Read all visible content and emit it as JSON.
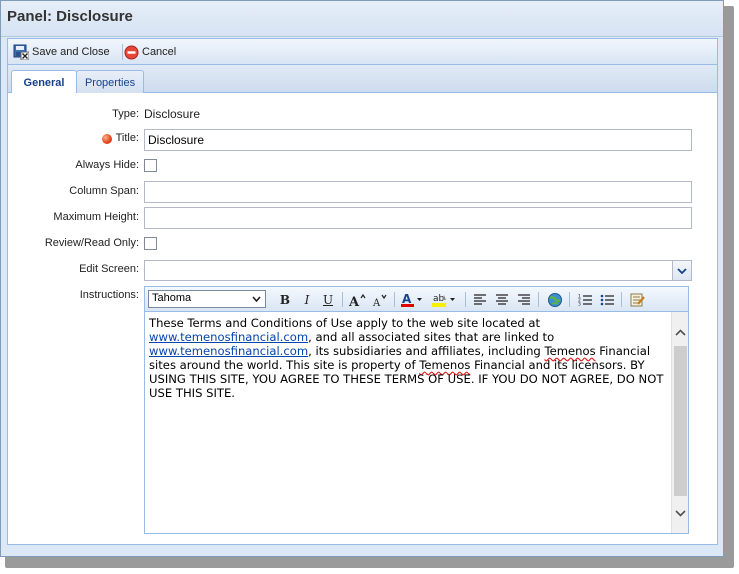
{
  "window": {
    "title": "Panel: Disclosure"
  },
  "toolbar": {
    "save_close_label": "Save and Close",
    "cancel_label": "Cancel"
  },
  "tabs": [
    {
      "label": "General",
      "active": true
    },
    {
      "label": "Properties",
      "active": false
    }
  ],
  "form": {
    "type_label": "Type:",
    "type_value": "Disclosure",
    "title_label": "Title:",
    "title_value": "Disclosure",
    "always_hide_label": "Always Hide:",
    "always_hide_checked": false,
    "column_span_label": "Column Span:",
    "column_span_value": "",
    "maximum_height_label": "Maximum Height:",
    "maximum_height_value": "",
    "review_read_only_label": "Review/Read Only:",
    "review_read_only_checked": false,
    "edit_screen_label": "Edit Screen:",
    "edit_screen_value": "",
    "instructions_label": "Instructions:"
  },
  "editor": {
    "font_family": "Tahoma",
    "toolbar_icons": [
      "bold-icon",
      "italic-icon",
      "underline-icon",
      "grow-font-icon",
      "shrink-font-icon",
      "font-color-icon",
      "highlight-color-icon",
      "align-left-icon",
      "align-center-icon",
      "align-right-icon",
      "insert-link-icon",
      "numbered-list-icon",
      "bullet-list-icon",
      "source-edit-icon"
    ],
    "content": {
      "part1": "These Terms and Conditions of Use apply to the web site located at ",
      "link1": "www.temenosfinancial.com",
      "part2": ", and all associated sites that are linked to ",
      "link2": "www.temenosfinancial.com",
      "part3": ", its subsidiaries and affiliates, including ",
      "word1": "Temenos",
      "part4": " Financial sites around the world. This site is property of ",
      "word2": "Temenos",
      "part5": " Financial and its licensors. BY USING THIS SITE, YOU AGREE TO THESE TERMS OF USE. IF YOU DO NOT AGREE, DO NOT USE THIS SITE."
    }
  },
  "colors": {
    "accent": "#15428b",
    "required": "#e0441a",
    "link": "#0645ad"
  }
}
